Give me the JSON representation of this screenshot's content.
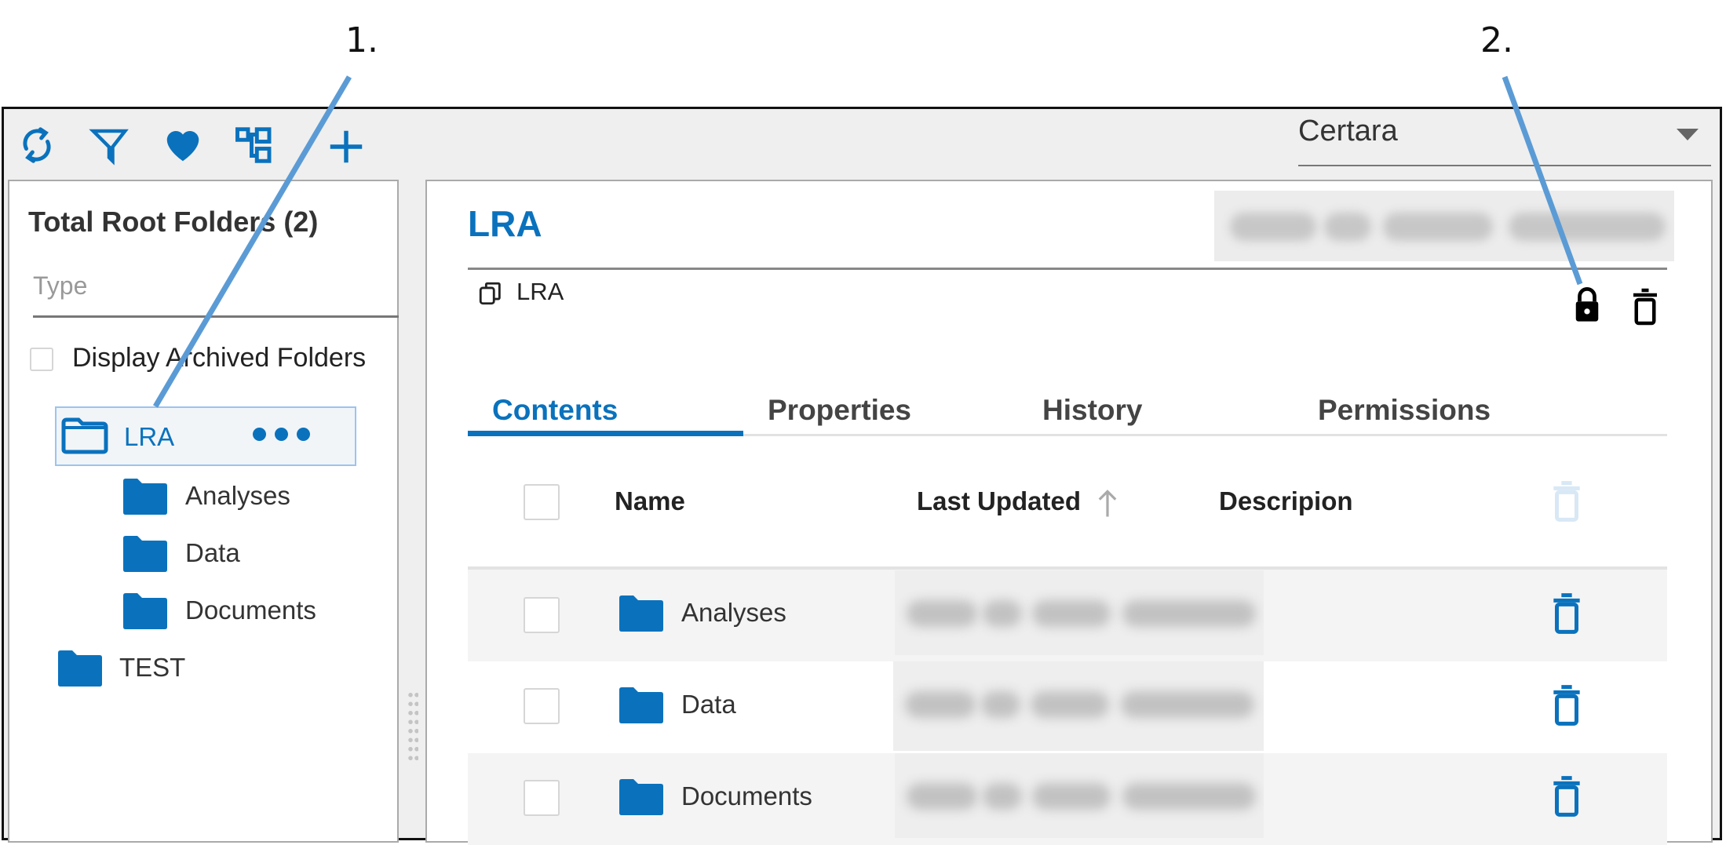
{
  "callouts": [
    {
      "label": "1."
    },
    {
      "label": "2."
    }
  ],
  "toolbar": {
    "icons": [
      "refresh-icon",
      "filter-icon",
      "favorites-heart-icon",
      "tree-view-icon",
      "add-icon"
    ]
  },
  "tenant_select": {
    "selected": "Certara"
  },
  "left_panel": {
    "title": "Total Root Folders (2)",
    "type_filter_placeholder": "Type",
    "display_archived_label": "Display Archived Folders",
    "tree": [
      {
        "label": "LRA",
        "selected": true,
        "expanded": true,
        "children": [
          {
            "label": "Analyses"
          },
          {
            "label": "Data"
          },
          {
            "label": "Documents"
          }
        ]
      },
      {
        "label": "TEST",
        "selected": false
      }
    ]
  },
  "detail": {
    "title": "LRA",
    "breadcrumb": "LRA",
    "tabs": [
      {
        "label": "Contents",
        "active": true
      },
      {
        "label": "Properties",
        "active": false
      },
      {
        "label": "History",
        "active": false
      },
      {
        "label": "Permissions",
        "active": false
      }
    ],
    "columns": {
      "name": "Name",
      "last_updated": "Last Updated",
      "description": "Descripion"
    },
    "sort": {
      "column": "last_updated",
      "direction": "ascending"
    },
    "rows": [
      {
        "name": "Analyses"
      },
      {
        "name": "Data"
      },
      {
        "name": "Documents"
      }
    ]
  },
  "colors": {
    "accent": "#0a72bd",
    "callout_line": "#5b9bd5"
  }
}
